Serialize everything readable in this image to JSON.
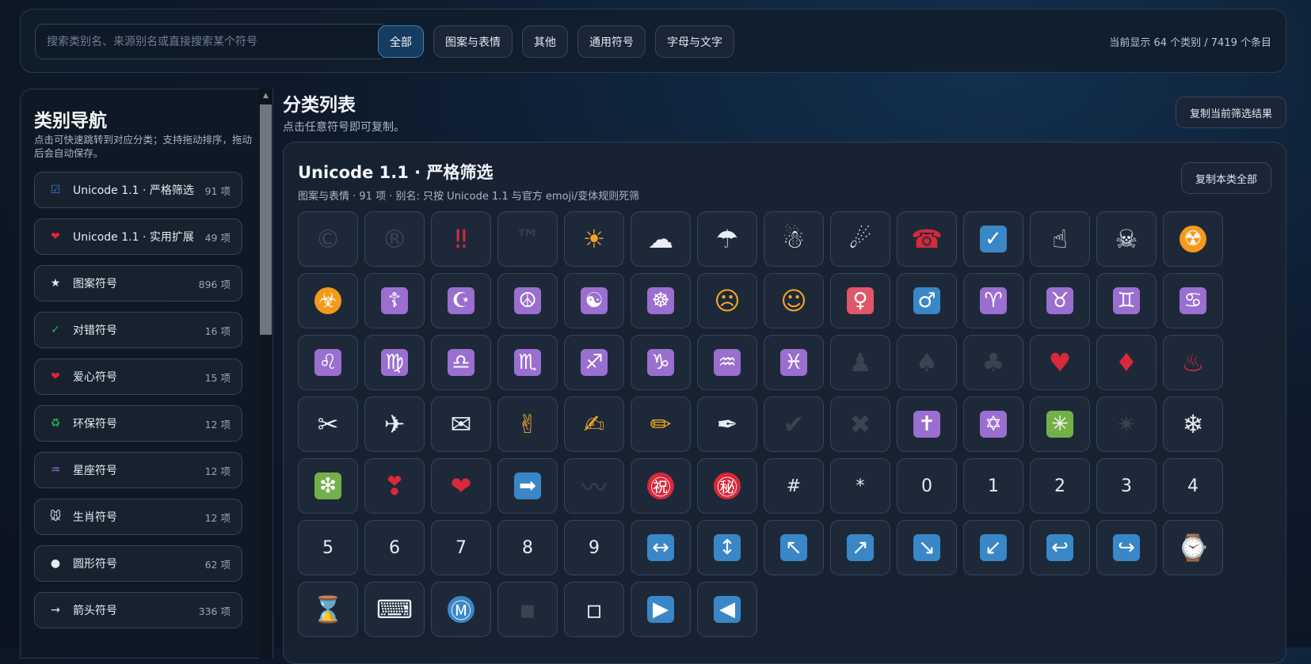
{
  "search": {
    "placeholder": "搜索类别名、来源别名或直接搜索某个符号"
  },
  "filters": [
    "全部",
    "图案与表情",
    "其他",
    "通用符号",
    "字母与文字"
  ],
  "active_filter": "全部",
  "stats": "当前显示 64 个类别 / 7419 个条目",
  "sidebar": {
    "title": "类别导航",
    "desc": "点击可快速跳转到对应分类；支持拖动排序，拖动后会自动保存。",
    "items": [
      {
        "icon": "☑",
        "label": "Unicode 1.1 · 严格筛选",
        "count": "91 项",
        "color": "#2d7fd1"
      },
      {
        "icon": "❤",
        "label": "Unicode 1.1 · 实用扩展",
        "count": "49 项",
        "color": "#e0243a"
      },
      {
        "icon": "★",
        "label": "图案符号",
        "count": "896 项",
        "color": "#e6ebf1"
      },
      {
        "icon": "✓",
        "label": "对错符号",
        "count": "16 项",
        "color": "#27b54a"
      },
      {
        "icon": "❤",
        "label": "爱心符号",
        "count": "15 项",
        "color": "#e0243a"
      },
      {
        "icon": "♻",
        "label": "环保符号",
        "count": "12 项",
        "color": "#27b54a"
      },
      {
        "icon": "♒",
        "label": "星座符号",
        "count": "12 项",
        "color": "#9a6fd0"
      },
      {
        "icon": "🐭",
        "label": "生肖符号",
        "count": "12 项",
        "color": "#e6ebf1"
      },
      {
        "icon": "●",
        "label": "圆形符号",
        "count": "62 项",
        "color": "#e6ebf1"
      },
      {
        "icon": "→",
        "label": "箭头符号",
        "count": "336 项",
        "color": "#e6ebf1"
      }
    ]
  },
  "main": {
    "title": "分类列表",
    "subtitle": "点击任意符号即可复制。",
    "copy_filter_label": "复制当前筛选结果"
  },
  "panel": {
    "title": "Unicode 1.1 · 严格筛选",
    "meta": "图案与表情 · 91 项 · 别名: 只按 Unicode 1.1 与官方 emoji/变体规则死筛",
    "copy_all_label": "复制本类全部",
    "symbols": [
      {
        "c": "©",
        "s": "dim"
      },
      {
        "c": "®",
        "s": "dim"
      },
      {
        "c": "‼",
        "s": "red"
      },
      {
        "c": "™",
        "s": "dim"
      },
      {
        "c": "☀",
        "s": "orange"
      },
      {
        "c": "☁",
        "s": ""
      },
      {
        "c": "☂",
        "s": ""
      },
      {
        "c": "☃",
        "s": ""
      },
      {
        "c": "☄",
        "s": ""
      },
      {
        "c": "☎",
        "s": "red"
      },
      {
        "c": "✓",
        "s": "box blue"
      },
      {
        "c": "☝",
        "s": ""
      },
      {
        "c": "☠",
        "s": ""
      },
      {
        "c": "☢",
        "s": "box circ orangebg"
      },
      {
        "c": "☣",
        "s": "box circ orangebg"
      },
      {
        "c": "☦",
        "s": "box purple"
      },
      {
        "c": "☪",
        "s": "box purple"
      },
      {
        "c": "☮",
        "s": "box purple"
      },
      {
        "c": "☯",
        "s": "box purple"
      },
      {
        "c": "☸",
        "s": "box purple"
      },
      {
        "c": "☹",
        "s": "orange"
      },
      {
        "c": "☺",
        "s": "orange"
      },
      {
        "c": "♀",
        "s": "box pink"
      },
      {
        "c": "♂",
        "s": "box blue"
      },
      {
        "c": "♈",
        "s": "box purple"
      },
      {
        "c": "♉",
        "s": "box purple"
      },
      {
        "c": "♊",
        "s": "box purple"
      },
      {
        "c": "♋",
        "s": "box purple"
      },
      {
        "c": "♌",
        "s": "box purple"
      },
      {
        "c": "♍",
        "s": "box purple"
      },
      {
        "c": "♎",
        "s": "box purple"
      },
      {
        "c": "♏",
        "s": "box purple"
      },
      {
        "c": "♐",
        "s": "box purple"
      },
      {
        "c": "♑",
        "s": "box purple"
      },
      {
        "c": "♒",
        "s": "box purple"
      },
      {
        "c": "♓",
        "s": "box purple"
      },
      {
        "c": "♟",
        "s": "dim"
      },
      {
        "c": "♠",
        "s": "dim"
      },
      {
        "c": "♣",
        "s": "dim"
      },
      {
        "c": "♥",
        "s": "red"
      },
      {
        "c": "♦",
        "s": "red"
      },
      {
        "c": "♨",
        "s": "red"
      },
      {
        "c": "✂",
        "s": ""
      },
      {
        "c": "✈",
        "s": ""
      },
      {
        "c": "✉",
        "s": ""
      },
      {
        "c": "✌",
        "s": "orange"
      },
      {
        "c": "✍",
        "s": "orange"
      },
      {
        "c": "✏",
        "s": "orange"
      },
      {
        "c": "✒",
        "s": ""
      },
      {
        "c": "✔",
        "s": "dim"
      },
      {
        "c": "✖",
        "s": "dim"
      },
      {
        "c": "✝",
        "s": "box purple"
      },
      {
        "c": "✡",
        "s": "box purple"
      },
      {
        "c": "✳",
        "s": "box green"
      },
      {
        "c": "✴",
        "s": "dim"
      },
      {
        "c": "❄",
        "s": ""
      },
      {
        "c": "❇",
        "s": "box green"
      },
      {
        "c": "❣",
        "s": "red"
      },
      {
        "c": "❤",
        "s": "red"
      },
      {
        "c": "➡",
        "s": "box blue"
      },
      {
        "c": "〰",
        "s": "dim"
      },
      {
        "c": "㊗",
        "s": "box circ redbg"
      },
      {
        "c": "㊙",
        "s": "box circ redbg"
      },
      {
        "c": "#",
        "s": "txt"
      },
      {
        "c": "*",
        "s": "txt"
      },
      {
        "c": "0",
        "s": "txt"
      },
      {
        "c": "1",
        "s": "txt"
      },
      {
        "c": "2",
        "s": "txt"
      },
      {
        "c": "3",
        "s": "txt"
      },
      {
        "c": "4",
        "s": "txt"
      },
      {
        "c": "5",
        "s": "txt"
      },
      {
        "c": "6",
        "s": "txt"
      },
      {
        "c": "7",
        "s": "txt"
      },
      {
        "c": "8",
        "s": "txt"
      },
      {
        "c": "9",
        "s": "txt"
      },
      {
        "c": "↔",
        "s": "box blue"
      },
      {
        "c": "↕",
        "s": "box blue"
      },
      {
        "c": "↖",
        "s": "box blue"
      },
      {
        "c": "↗",
        "s": "box blue"
      },
      {
        "c": "↘",
        "s": "box blue"
      },
      {
        "c": "↙",
        "s": "box blue"
      },
      {
        "c": "↩",
        "s": "box blue"
      },
      {
        "c": "↪",
        "s": "box blue"
      },
      {
        "c": "⌚",
        "s": ""
      },
      {
        "c": "⌛",
        "s": "orange"
      },
      {
        "c": "⌨",
        "s": ""
      },
      {
        "c": "Ⓜ",
        "s": "box circ blue"
      },
      {
        "c": "▪",
        "s": "dim"
      },
      {
        "c": "▫",
        "s": ""
      },
      {
        "c": "▶",
        "s": "box blue"
      },
      {
        "c": "◀",
        "s": "box blue"
      }
    ]
  }
}
